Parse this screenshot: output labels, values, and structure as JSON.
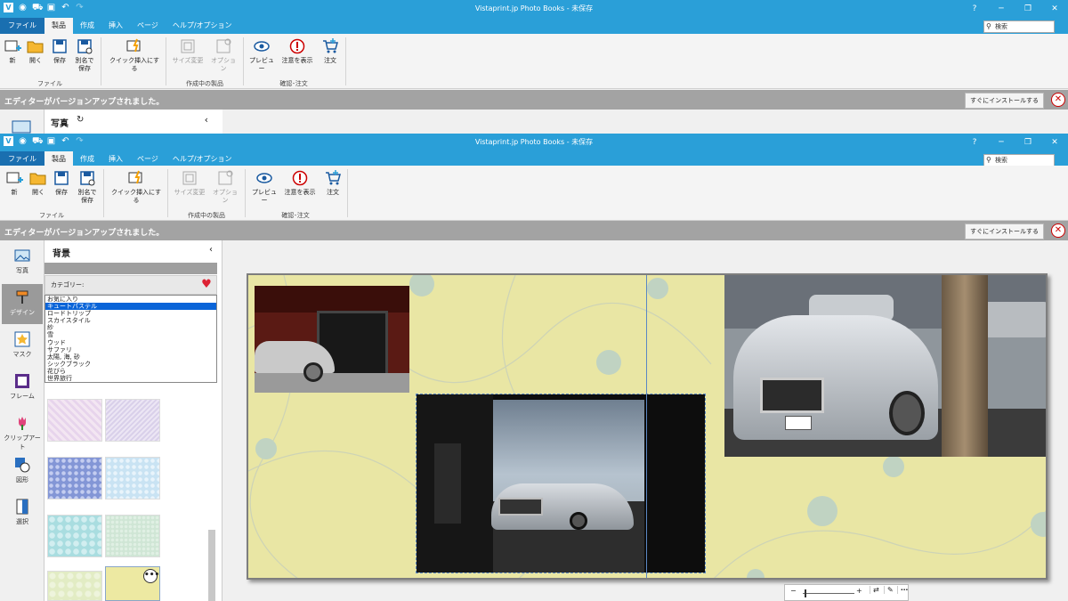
{
  "app": {
    "title": "Vistaprint.jp Photo Books - 未保存",
    "help": "?",
    "minimize": "─",
    "restore": "❐",
    "close": "✕"
  },
  "quick_access": [
    "eye-icon",
    "cart-icon",
    "save-icon",
    "undo-icon",
    "redo-icon"
  ],
  "menu": {
    "file": "ファイル",
    "tabs": [
      "製品",
      "作成",
      "挿入",
      "ページ",
      "ヘルプ/オプション"
    ],
    "search_placeholder": "検索"
  },
  "ribbon": {
    "new": "新",
    "open": "開く",
    "save": "保存",
    "save_as": "別名で保存",
    "group_file": "ファイル",
    "quick_insert": "クイック挿入にする",
    "resize": "サイズ変更",
    "options": "オプション",
    "group_product": "作成中の製品",
    "preview": "プレビュー",
    "notices": "注意を表示",
    "order": "注文",
    "group_check": "確認･注文"
  },
  "notice": {
    "message": "エディターがバージョンアップされました。",
    "install": "すぐにインストールする"
  },
  "back_panel": {
    "title": "写真"
  },
  "rail": [
    "写真",
    "デザイン",
    "マスク",
    "フレーム",
    "クリップアート",
    "図形",
    "選択"
  ],
  "panel": {
    "title": "背景",
    "collapse": "‹",
    "category_label": "カテゴリー:",
    "categories": [
      "お気に入り",
      "キュートパステル",
      "ロードトリップ",
      "スカイスタイル",
      "紗",
      "雪",
      "ウッド",
      "サファリ",
      "太陽, 海, 砂",
      "シックブラック",
      "花びら",
      "世界旅行"
    ],
    "selected_index": 1
  },
  "zoom": {
    "minus": "−",
    "plus": "+"
  },
  "colors": {
    "titlebar": "#2a9fd8",
    "page_background": "#e9e6a4",
    "selected": "#0a64d8"
  }
}
